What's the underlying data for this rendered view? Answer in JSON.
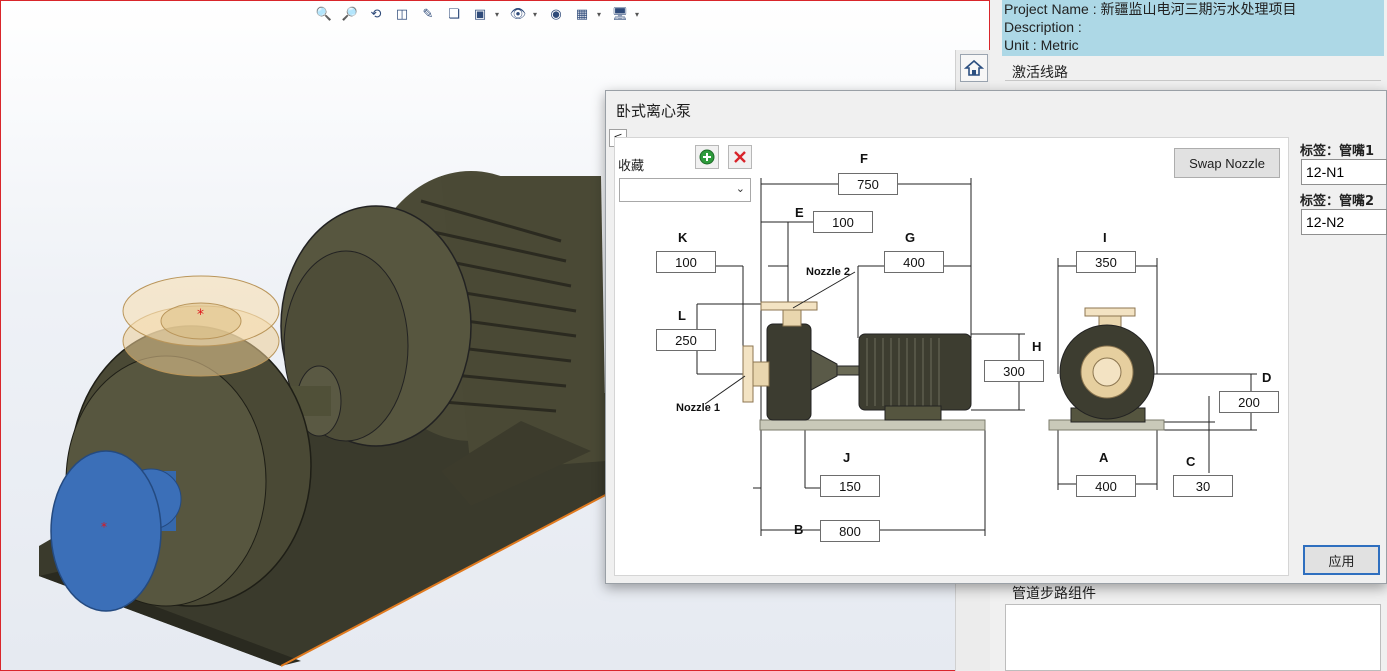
{
  "toolbar": {
    "icons": [
      "zoom-fit-icon",
      "zoom-area-icon",
      "previous-view-icon",
      "section-view-icon",
      "dynamic-annotation-icon",
      "view-orientation-icon",
      "display-style-icon",
      "hide-show-icon",
      "edit-appearance-icon",
      "apply-scene-icon",
      "view-settings-icon"
    ]
  },
  "project": {
    "name_line": "Project Name : 新疆监山电河三期污水处理项目",
    "description_line": "Description :",
    "unit_line": "Unit : Metric"
  },
  "panel": {
    "route_section": "激活线路",
    "assembly_section": "管道步路组件"
  },
  "dialog": {
    "title": "卧式离心泵",
    "collapse_label": "<",
    "favorites_label": "收藏",
    "favorites_value": "",
    "swap_label": "Swap Nozzle",
    "tag1_label": "标签：管嘴1",
    "tag1_value": "12-N1",
    "tag2_label": "标签：管嘴2",
    "tag2_value": "12-N2",
    "apply_label": "应用"
  },
  "dimensions": {
    "F": {
      "letter": "F",
      "value": "750"
    },
    "E": {
      "letter": "E",
      "value": "100"
    },
    "K": {
      "letter": "K",
      "value": "100"
    },
    "G": {
      "letter": "G",
      "value": "400"
    },
    "I": {
      "letter": "I",
      "value": "350"
    },
    "L": {
      "letter": "L",
      "value": "250"
    },
    "H": {
      "letter": "H",
      "value": "300"
    },
    "D": {
      "letter": "D",
      "value": "200"
    },
    "J": {
      "letter": "J",
      "value": "150"
    },
    "A": {
      "letter": "A",
      "value": "400"
    },
    "C": {
      "letter": "C",
      "value": "30"
    },
    "B": {
      "letter": "B",
      "value": "800"
    }
  },
  "nozzles": {
    "n1": "Nozzle 1",
    "n2": "Nozzle 2"
  },
  "colors": {
    "project_bg": "#add8e6",
    "pump_body": "#3d3d30",
    "flange": "#f3e3c3",
    "nozzle_blue": "#3b6fb8",
    "frame_red": "#d9262b"
  }
}
